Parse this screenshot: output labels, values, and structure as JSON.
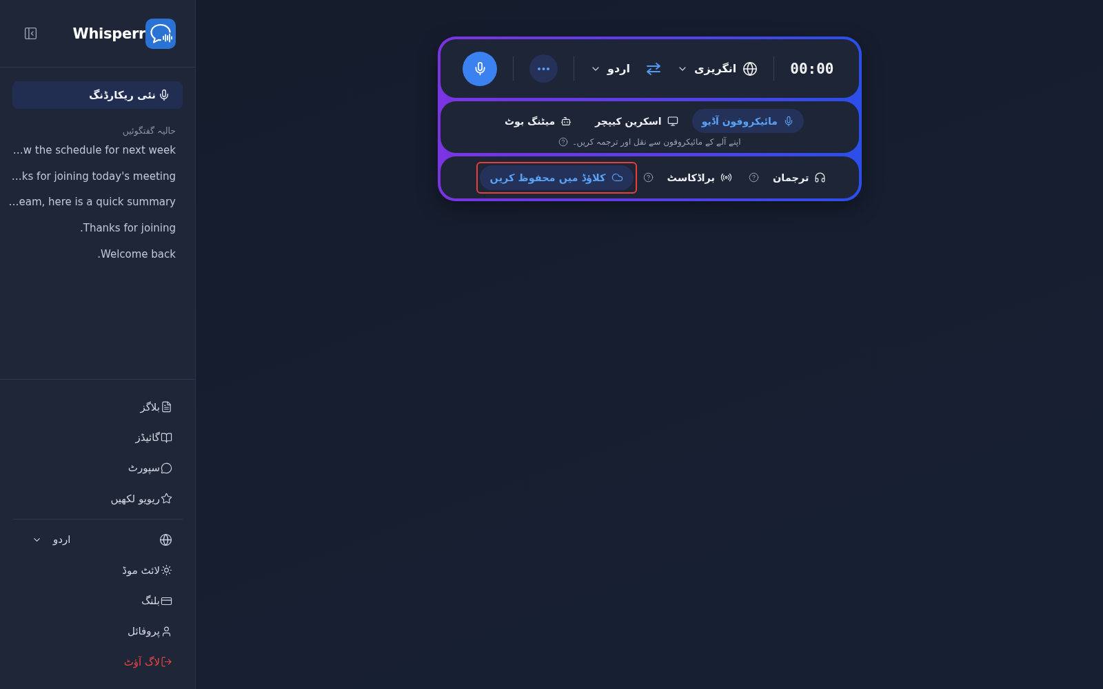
{
  "sidebar": {
    "app_name": "Whisperr",
    "new_recording": {
      "label": "نئی ریکارڈنگ"
    },
    "recent_heading": "حالیہ گفتگوئیں",
    "recent": [
      "w the schedule for next week…",
      "ks for joining today's meeting…",
      "eam, here is a quick summary…",
      "Thanks for joining.",
      "Welcome back."
    ],
    "nav": [
      {
        "label": "بلاگز"
      },
      {
        "label": "گائیڈز"
      },
      {
        "label": "سپورٹ"
      },
      {
        "label": "ریویو لکھیں"
      }
    ],
    "language": {
      "value": "اردو"
    },
    "settings": [
      {
        "kind": "link",
        "label": "لائٹ موڈ"
      },
      {
        "kind": "link",
        "label": "بلنگ"
      },
      {
        "kind": "link",
        "label": "پروفائل"
      },
      {
        "kind": "danger",
        "label": "لاگ آؤٹ"
      }
    ]
  },
  "recorder": {
    "timer": "00:00",
    "source_language": {
      "value": "انگریزی"
    },
    "target_language": {
      "value": "اردو"
    },
    "sources": [
      {
        "label": "مائیکروفون آڈیو",
        "selected": true
      },
      {
        "label": "اسکرین کیپچر",
        "selected": false
      },
      {
        "label": "میٹنگ بوٹ",
        "selected": false
      }
    ],
    "source_description": "اپنے آلے کے مائیکروفون سے نقل اور ترجمہ کریں۔",
    "options": [
      {
        "label": "ترجمان",
        "on": false,
        "help": true,
        "highlighted": false
      },
      {
        "label": "براڈکاسٹ",
        "on": false,
        "help": true,
        "highlighted": false
      },
      {
        "label": "کلاؤڈ میں محفوظ کریں",
        "on": true,
        "help": false,
        "highlighted": true
      }
    ]
  }
}
